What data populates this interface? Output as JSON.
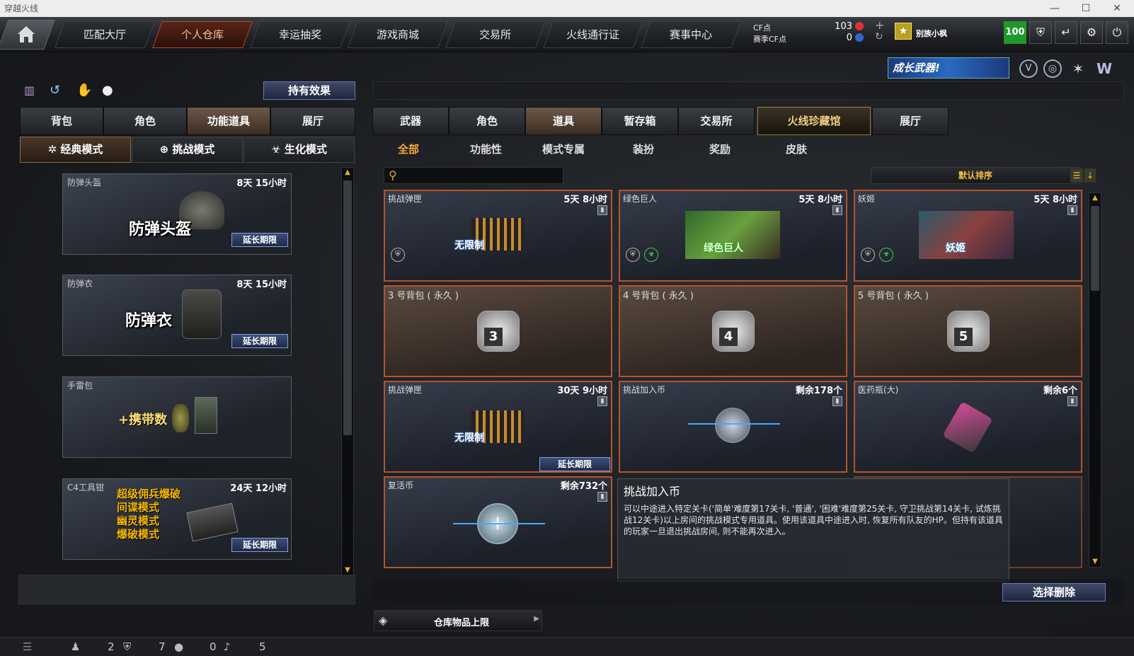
{
  "window": {
    "title": "穿越火线",
    "min": "—",
    "max": "☐",
    "close": "✕"
  },
  "nav": {
    "tabs": [
      {
        "label": "匹配大厅"
      },
      {
        "label": "个人仓库"
      },
      {
        "label": "幸运抽奖"
      },
      {
        "label": "游戏商城"
      },
      {
        "label": "交易所"
      },
      {
        "label": "火线通行证"
      },
      {
        "label": "赛事中心"
      }
    ],
    "cf_label": "CF点",
    "season_label": "赛季CF点",
    "cf_value": "103",
    "season_value": "0",
    "plus": "+",
    "username": "别族小枫",
    "level": "100"
  },
  "banner": {
    "text": "成长武器!"
  },
  "left": {
    "effect_button": "持有效果",
    "tabs": [
      "背包",
      "角色",
      "功能道具",
      "展厅"
    ],
    "modes": [
      "经典模式",
      "挑战模式",
      "生化模式"
    ],
    "items": [
      {
        "name": "防弹头盔",
        "time": "8天 15小时",
        "big": "防弹头盔",
        "extend": "延长期限"
      },
      {
        "name": "防弹衣",
        "time": "8天 15小时",
        "big": "防弹衣",
        "extend": "延长期限"
      },
      {
        "name": "手雷包",
        "time": "",
        "big": "+携带数",
        "extend": ""
      },
      {
        "name": "C4工具钳",
        "time": "24天 12小时",
        "modes": [
          "超级佣兵爆破",
          "间谍模式",
          "幽灵模式",
          "爆破模式"
        ],
        "extend": "延长期限"
      }
    ]
  },
  "right": {
    "tabs": [
      "武器",
      "角色",
      "道具",
      "暂存箱",
      "交易所",
      "火线珍藏馆",
      "展厅"
    ],
    "subtabs": [
      "全部",
      "功能性",
      "模式专属",
      "装扮",
      "奖励",
      "皮肤"
    ],
    "search_placeholder": "",
    "sort": "默认排序",
    "items": [
      {
        "name": "挑战弹匣",
        "time": "5天 8小时",
        "label": "无限制"
      },
      {
        "name": "绿色巨人",
        "time": "5天 8小时",
        "label": "绿色巨人"
      },
      {
        "name": "妖姬",
        "time": "5天 8小时",
        "label": "妖姬"
      },
      {
        "name": "3 号背包 ( 永久 )",
        "time": "",
        "label": "3"
      },
      {
        "name": "4 号背包 ( 永久 )",
        "time": "",
        "label": "4"
      },
      {
        "name": "5 号背包 ( 永久 )",
        "time": "",
        "label": "5"
      },
      {
        "name": "挑战弹匣",
        "time": "30天 9小时",
        "label": "无限制",
        "extend": "延长期限"
      },
      {
        "name": "挑战加入币",
        "time": "剩余178个",
        "label": ""
      },
      {
        "name": "医药瓶(大)",
        "time": "剩余6个",
        "label": ""
      },
      {
        "name": "复活币",
        "time": "剩余732个",
        "label": ""
      }
    ],
    "tooltip": {
      "title": "挑战加入币",
      "desc": "可以中途进入特定关卡('简单'难度第17关卡, '普通', '困难'难度第25关卡, 守卫挑战第14关卡, 试炼挑战12关卡)以上房间的挑战模式专用道具。使用该道具中途进入时, 恢复所有队友的HP。但持有该道具的玩家一旦退出挑战房间, 则不能再次进入。"
    },
    "delete_button": "选择删除",
    "capacity": "仓库物品上限"
  },
  "status": {
    "friends": "2",
    "mail": "7",
    "chat": "0",
    "volume": "5"
  },
  "colors": {
    "accent": "#b3552c",
    "extend": "#2a3b62",
    "level": "#2aa02a"
  }
}
